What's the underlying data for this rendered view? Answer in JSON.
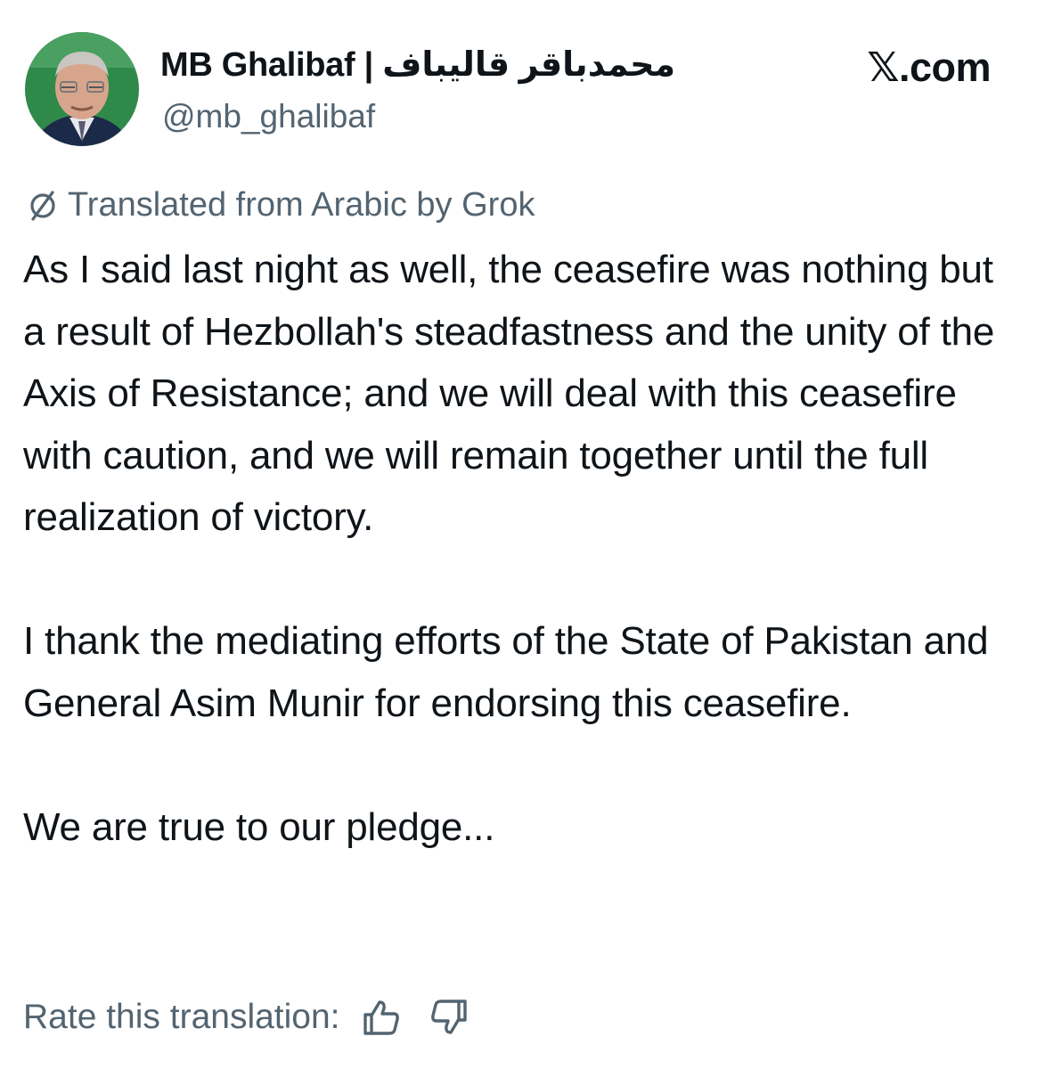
{
  "author": {
    "display_name": "MB Ghalibaf | محمدباقر قالیباف",
    "handle": "@mb_ghalibaf",
    "avatar_icon": "profile-photo"
  },
  "site": {
    "label": "𝕏.com"
  },
  "translation": {
    "notice": "Translated from Arabic by Grok",
    "icon": "translate-slash-icon"
  },
  "tweet": {
    "paragraphs": [
      "As I said last night as well, the ceasefire was nothing but a result of Hezbollah's steadfastness and the unity of the Axis of Resistance; and we will deal with this ceasefire with caution, and we will remain together until the full realization of victory.",
      "I thank the mediating efforts of the State of Pakistan and General Asim Munir for endorsing this ceasefire.",
      "We are true to our pledge..."
    ]
  },
  "rating": {
    "label": "Rate this translation:",
    "up_icon": "thumbs-up-icon",
    "down_icon": "thumbs-down-icon"
  },
  "colors": {
    "text": "#0f1419",
    "secondary": "#536471",
    "background": "#ffffff"
  }
}
